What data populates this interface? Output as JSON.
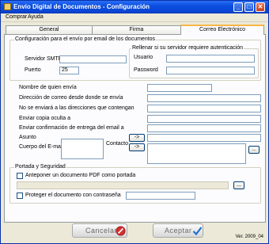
{
  "window": {
    "title": "Envío Digital de Documentos - Configuración",
    "minimize": "_",
    "maximize": "□",
    "close": "✕"
  },
  "menu": {
    "items": [
      "Comprar",
      "Ayuda"
    ]
  },
  "tabs": [
    {
      "label": "General",
      "active": false
    },
    {
      "label": "Firma",
      "active": false
    },
    {
      "label": "Correo Electrónico",
      "active": true
    }
  ],
  "email_group": {
    "legend": "Configuración para el envío por email de los documentos",
    "smtp_label": "Servidor SMTP",
    "smtp_value": "",
    "port_label": "Puerto",
    "port_value": "25",
    "auth_legend": "Rellenar si su servidor requiere autenticación",
    "user_label": "Usuario",
    "user_value": "",
    "password_label": "Password",
    "password_value": ""
  },
  "fields": {
    "sender_name_label": "Nombre de quien envía",
    "sender_address_label": "Dirección de correo desde donde se envía",
    "exclude_label": "No se enviará a las  direcciones que contengan",
    "bcc_label": "Enviar copia oculta a",
    "receipt_label": "Enviar confirmación de entrega del email a",
    "subject_label": "Asunto",
    "body_label": "Cuerpo del E-mail",
    "contact_label": "Contacto",
    "arrow": "->",
    "ellipsis": "..."
  },
  "portada_group": {
    "legend": "Portada y Seguridad",
    "prepend_pdf_label": "Anteponer un documento PDF como portada",
    "prepend_pdf_checked": false,
    "pdf_path": "",
    "protect_label": "Proteger el documento con contraseña",
    "protect_checked": false,
    "protect_password": ""
  },
  "footer": {
    "cancel_label": "Cancelar",
    "accept_label": "Aceptar",
    "version": "Ver. 2009_04"
  }
}
